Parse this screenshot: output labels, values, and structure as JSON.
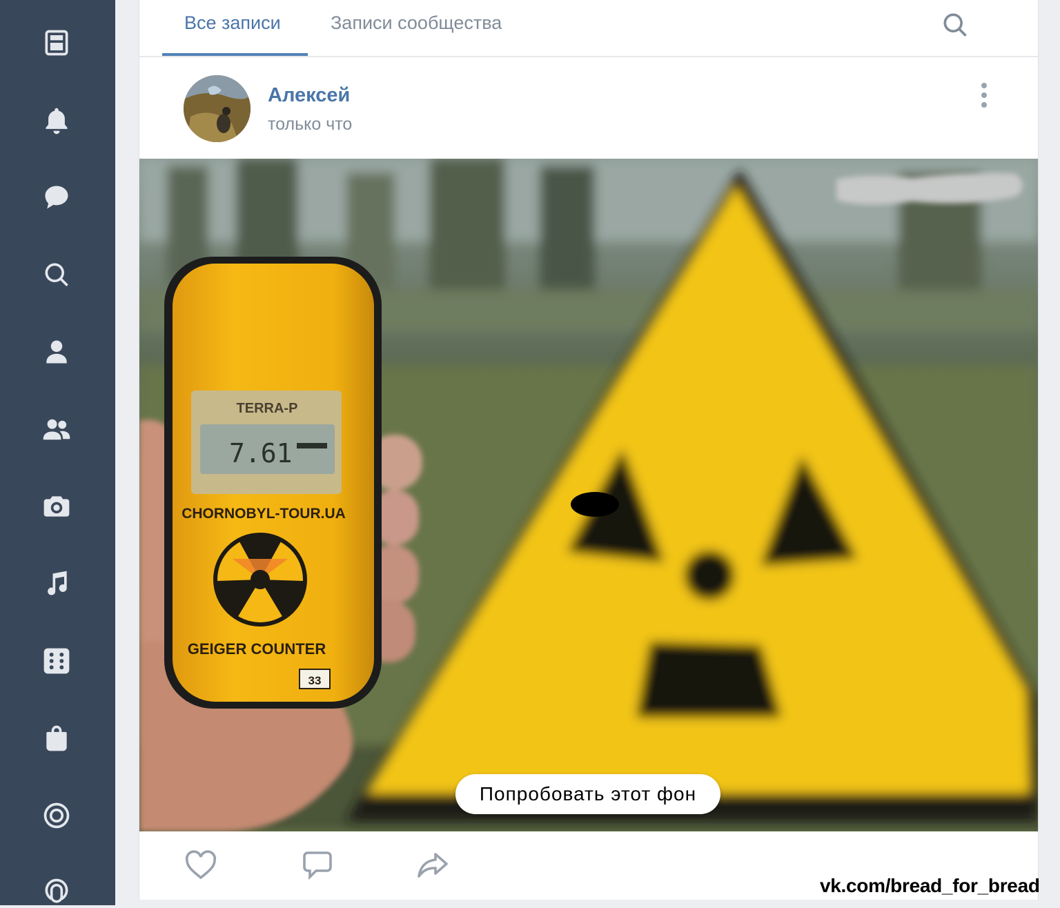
{
  "sidebar": {
    "items": [
      {
        "icon": "news-icon"
      },
      {
        "icon": "bell-icon"
      },
      {
        "icon": "message-icon"
      },
      {
        "icon": "search-icon"
      },
      {
        "icon": "profile-icon"
      },
      {
        "icon": "friends-icon"
      },
      {
        "icon": "camera-icon"
      },
      {
        "icon": "music-icon"
      },
      {
        "icon": "apps-icon"
      },
      {
        "icon": "shopping-bag-icon"
      },
      {
        "icon": "target-icon"
      },
      {
        "icon": "podcast-icon"
      }
    ]
  },
  "tabs": {
    "all_posts": "Все записи",
    "community_posts": "Записи сообщества"
  },
  "post": {
    "author": "Алексей",
    "time": "только что",
    "image": {
      "device_brand": "TERRA-P",
      "device_reading": "7.61",
      "device_site": "CHORNOBYL-TOUR.UA",
      "device_label": "GEIGER COUNTER",
      "device_number": "33"
    },
    "try_background": "Попробовать этот фон"
  },
  "actions": {
    "like": "heart-icon",
    "comment": "comment-icon",
    "share": "share-icon"
  },
  "watermark": "vk.com/bread_for_bread",
  "colors": {
    "sidebar_bg": "#39475a",
    "accent": "#4a76a8",
    "muted": "#818c99",
    "warning_yellow": "#f2c418"
  }
}
